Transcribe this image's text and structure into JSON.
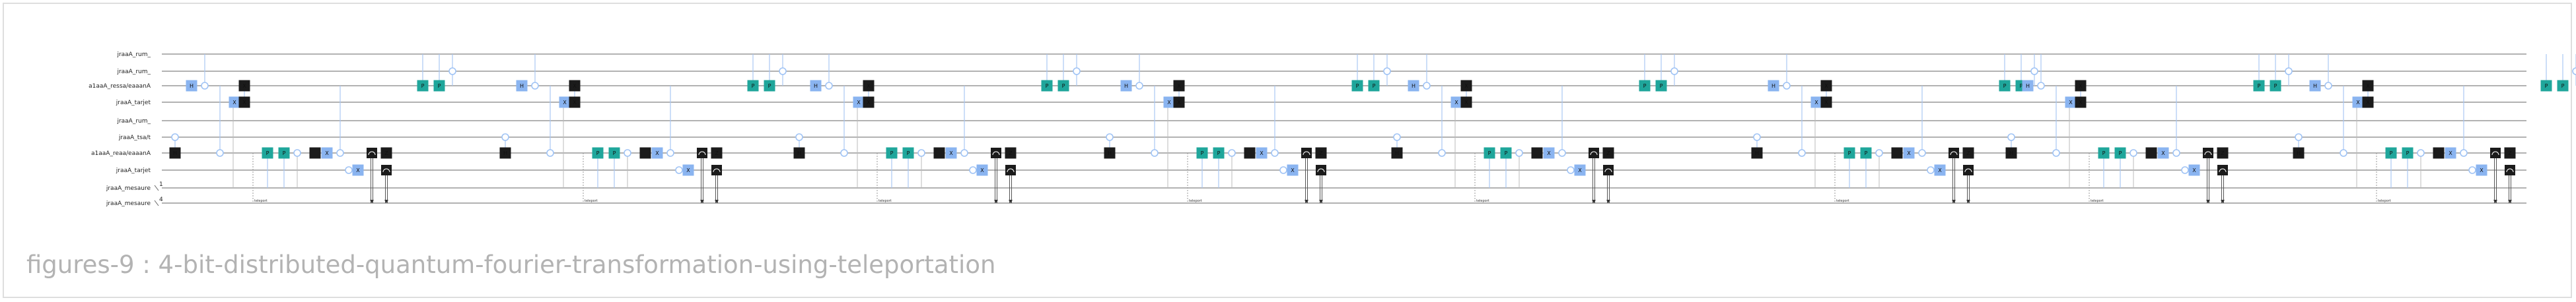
{
  "caption": "figures-9 : 4-bit-distributed-quantum-fourier-transformation-using-teleportation",
  "wires": {
    "labels": [
      "jraaA_rum_",
      "jraaA_rum_",
      "a1aaA_ressa/eaaanA",
      "jraaA_tarjet",
      "jraaA_rum_",
      "jraaA_tsa/t",
      "a1aaA_reaa/eaaanA",
      "jraaA_tarjet",
      "jraaA_mesaure",
      "jraaA_mesaure"
    ],
    "classical_indices": [
      "1",
      "4"
    ]
  },
  "gate_labels": {
    "hadamard": "H",
    "x": "X",
    "z": "Z",
    "p": "P",
    "measure": "⌒"
  },
  "colors": {
    "wire": "#666666",
    "hadamard_blue": "#8ab4f0",
    "phase_teal": "#1fa69b",
    "cx_black": "#1b1b1b",
    "control_blue": "#9fc3f5",
    "caption": "#b3b3b3"
  },
  "barrier_labels": [
    "teleport",
    "teleport",
    "teleport",
    "teleport",
    "teleport",
    "teleport",
    "teleport",
    "teleport"
  ]
}
